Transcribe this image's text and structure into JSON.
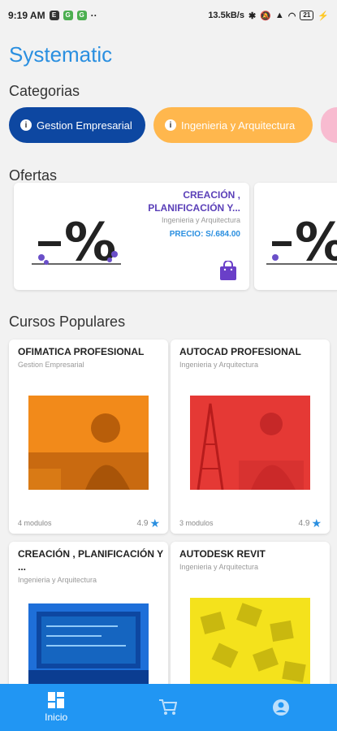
{
  "status_bar": {
    "time": "9:19 AM",
    "network_speed": "13.5kB/s",
    "battery": "21"
  },
  "app_title": "Systematic",
  "sections": {
    "categories": "Categorias",
    "offers": "Ofertas",
    "popular": "Cursos Populares"
  },
  "categories": [
    {
      "label": "Gestion Empresarial",
      "color": "#0d47a1"
    },
    {
      "label": "Ingenieria y Arquitectura",
      "color": "#ffb74d"
    }
  ],
  "offer": {
    "title": "CREACIÓN , PLANIFICACIÓN Y...",
    "category": "Ingenieria y Arquitectura",
    "price": "PRECIO: S/.684.00"
  },
  "courses": [
    {
      "title": "OFIMATICA PROFESIONAL",
      "category": "Gestion Empresarial",
      "modules": "4 modulos",
      "rating": "4.9",
      "tint": "#f28a1a"
    },
    {
      "title": "AUTOCAD PROFESIONAL",
      "category": "Ingenieria y Arquitectura",
      "modules": "3 modulos",
      "rating": "4.9",
      "tint": "#e53935"
    },
    {
      "title": "CREACIÓN , PLANIFICACIÓN Y ...",
      "category": "Ingenieria y Arquitectura",
      "tint": "#1e6fd9"
    },
    {
      "title": "AUTODESK REVIT",
      "category": "Ingenieria y Arquitectura",
      "tint": "#f4e21c"
    }
  ],
  "nav": {
    "home_label": "Inicio"
  },
  "colors": {
    "brand": "#2a8fe0",
    "nav_bg": "#2196f3",
    "offer_accent": "#5a3fb8"
  },
  "icons": [
    "info-icon",
    "percent-illustration",
    "shopping-bag-icon",
    "star-icon",
    "dashboard-icon",
    "cart-icon",
    "account-icon"
  ]
}
